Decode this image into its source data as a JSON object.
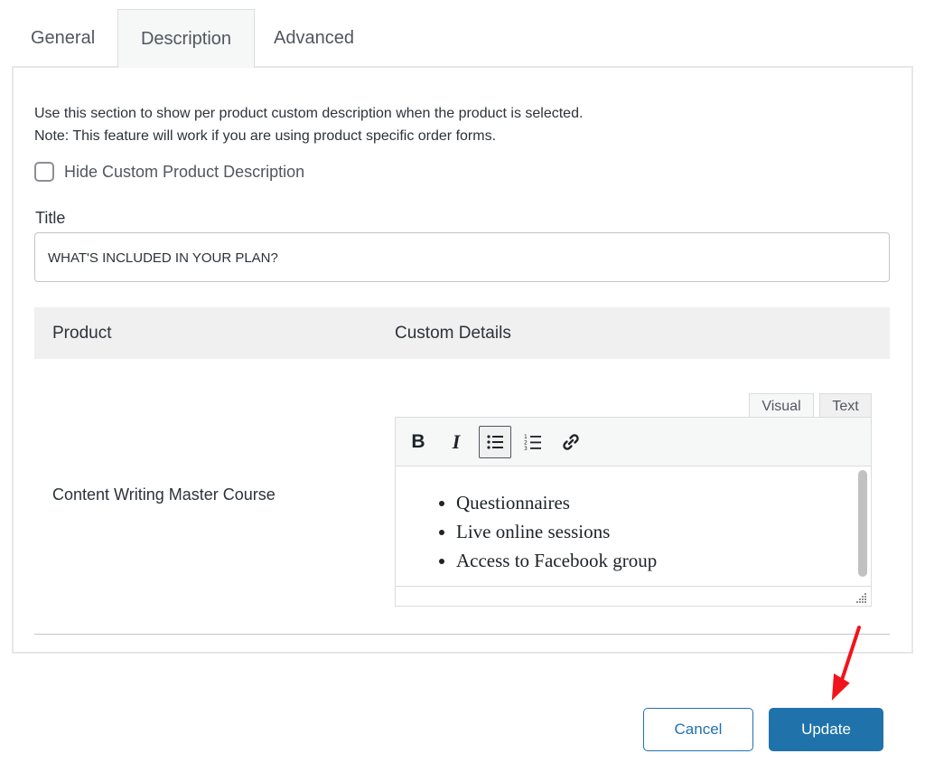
{
  "tabs": [
    {
      "label": "General",
      "active": false
    },
    {
      "label": "Description",
      "active": true
    },
    {
      "label": "Advanced",
      "active": false
    }
  ],
  "section": {
    "description_line1": "Use this section to show per product custom description when the product is selected.",
    "description_line2": "Note: This feature will work if you are using product specific order forms.",
    "hide_checkbox_label": "Hide Custom Product Description",
    "hide_checkbox_checked": false
  },
  "title_field": {
    "label": "Title",
    "value": "WHAT'S INCLUDED IN YOUR PLAN?"
  },
  "table": {
    "headers": [
      "Product",
      "Custom Details"
    ],
    "rows": [
      {
        "product": "Content Writing Master Course"
      }
    ]
  },
  "editor": {
    "mode_tabs": [
      "Visual",
      "Text"
    ],
    "active_mode": "Visual",
    "toolbar": [
      "bold-icon",
      "italic-icon",
      "bulleted-list-icon",
      "numbered-list-icon",
      "link-icon"
    ],
    "items": [
      "Questionnaires",
      "Live online sessions",
      "Access to Facebook group"
    ]
  },
  "footer": {
    "cancel_label": "Cancel",
    "update_label": "Update"
  },
  "colors": {
    "primary": "#2271b1",
    "update_bg": "#1f73aa",
    "annotation_arrow": "#f2141c"
  }
}
